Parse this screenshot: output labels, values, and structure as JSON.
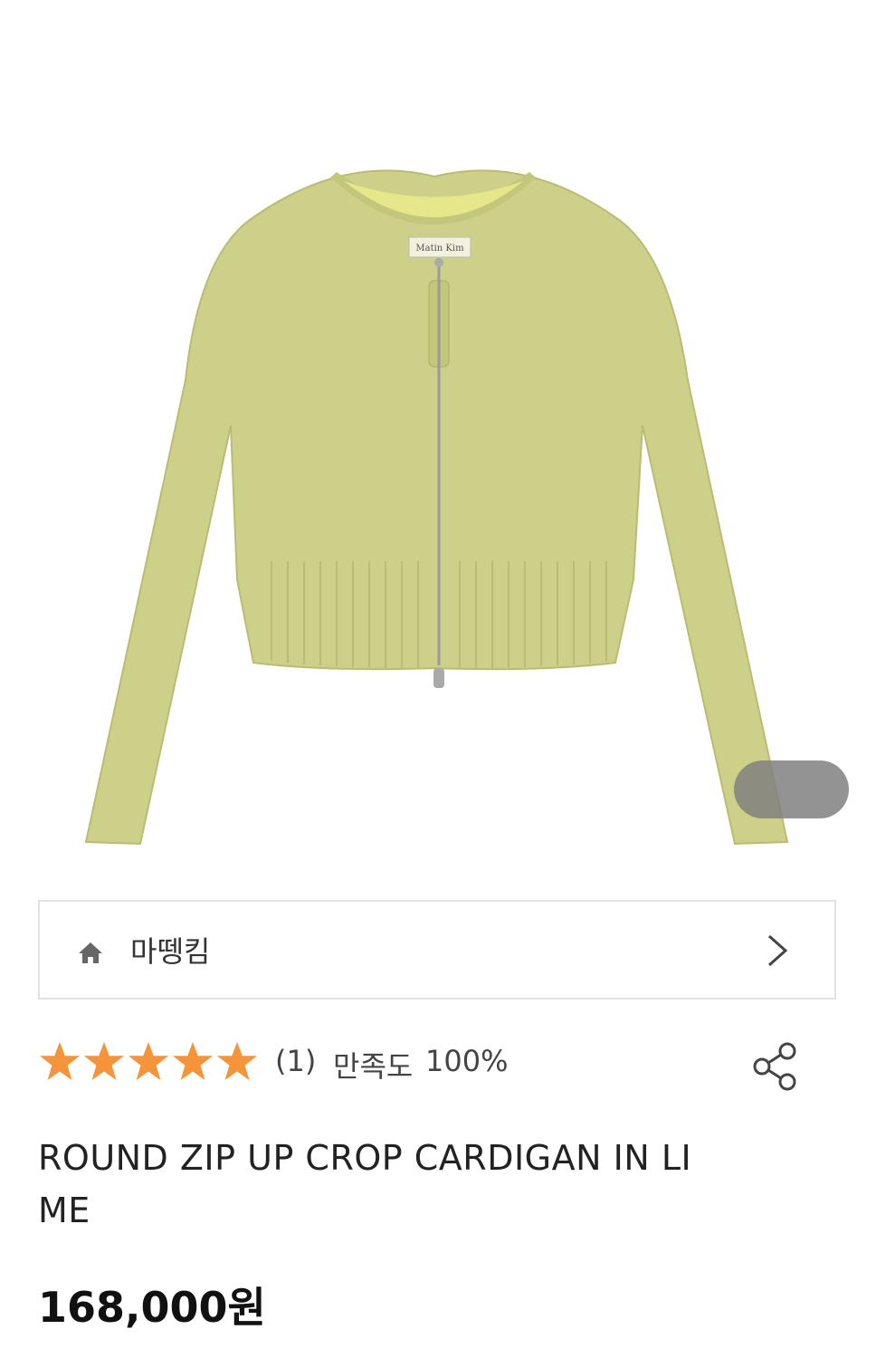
{
  "product_image": {
    "label_text": "Matin Kim",
    "icon": "cardigan-product-photo",
    "garment_color": "#cdd088"
  },
  "brand": {
    "name": "마뗑킴",
    "home_icon": "home-icon",
    "chevron_icon": "chevron-right-icon"
  },
  "rating": {
    "stars": 5,
    "review_count": "(1)",
    "satisfaction_label": "만족도",
    "satisfaction_value": "100%",
    "star_color": "#f5943b"
  },
  "share": {
    "icon": "share-icon"
  },
  "product": {
    "title": "ROUND ZIP UP CROP CARDIGAN IN LIME",
    "price": "168,000원"
  }
}
